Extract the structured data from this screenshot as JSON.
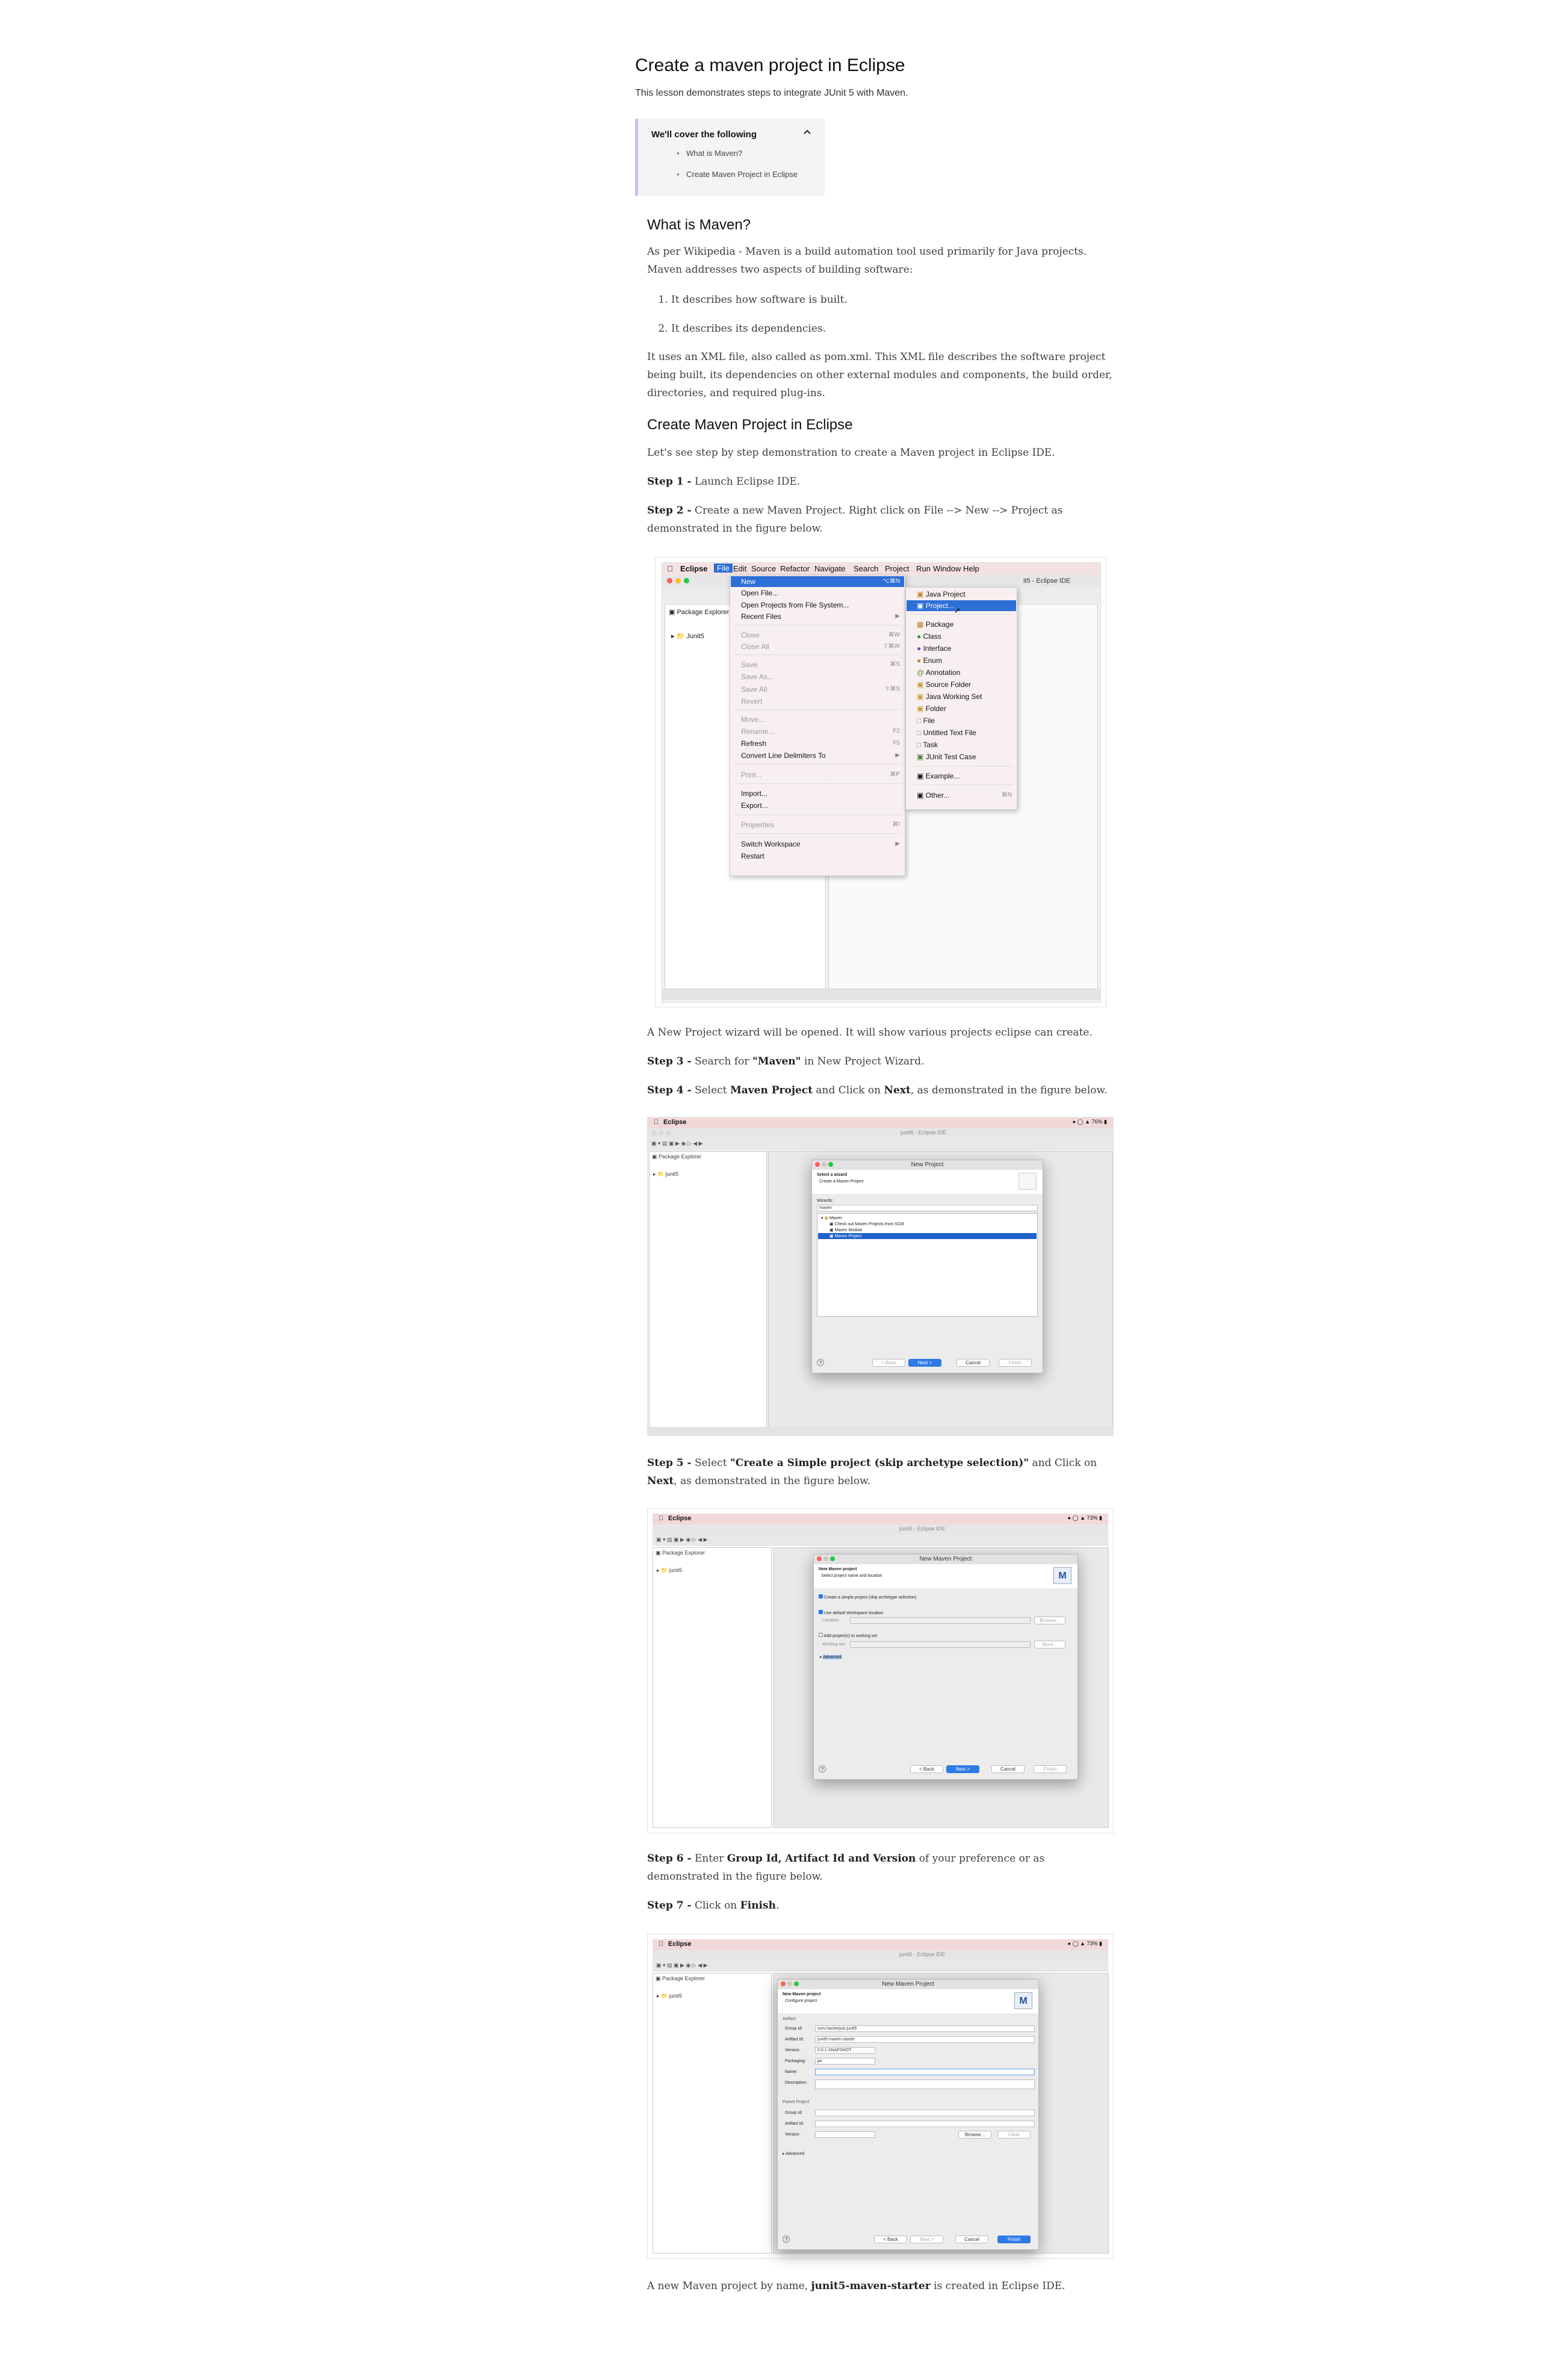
{
  "page": {
    "title": "Create a maven project in Eclipse",
    "intro": "This lesson demonstrates steps to integrate JUnit 5 with Maven."
  },
  "cover": {
    "heading": "We'll cover the following",
    "items": [
      "What is Maven?",
      "Create Maven Project in Eclipse"
    ]
  },
  "section1": {
    "heading": "What is Maven?",
    "para1": "As per Wikipedia - Maven is a build automation tool used primarily for Java projects. Maven addresses two aspects of building software:",
    "list": [
      "It describes how software is built.",
      "It describes its dependencies."
    ],
    "para2": "It uses an XML file, also called as pom.xml. This XML file describes the software project being built, its dependencies on other external modules and components, the build order, directories, and required plug-ins."
  },
  "section2": {
    "heading": "Create Maven Project in Eclipse",
    "intro": "Let's see step by step demonstration to create a Maven project in Eclipse IDE.",
    "step1_label": "Step 1 -",
    "step1_text": " Launch Eclipse IDE.",
    "step2_label": "Step 2 -",
    "step2_text": " Create a new Maven Project. Right click on File --> New --> Project as demonstrated in the figure below.",
    "wizard_note": "A New Project wizard will be opened. It will show various projects eclipse can create.",
    "step3_label": "Step 3 -",
    "step3_a": " Search for ",
    "step3_b": "\"Maven\"",
    "step3_c": " in New Project Wizard.",
    "step4_label": "Step 4 -",
    "step4_a": " Select ",
    "step4_b": "Maven Project",
    "step4_c": " and Click on ",
    "step4_d": "Next",
    "step4_e": ", as demonstrated in the figure below.",
    "step5_label": "Step 5 -",
    "step5_a": " Select ",
    "step5_b": "\"Create a Simple project (skip archetype selection)\"",
    "step5_c": " and Click on ",
    "step5_d": "Next",
    "step5_e": ", as demonstrated in the figure below.",
    "step6_label": "Step 6 -",
    "step6_a": " Enter ",
    "step6_b": "Group Id, Artifact Id and Version",
    "step6_c": " of your preference or as demonstrated in the figure below.",
    "step7_label": "Step 7 -",
    "step7_a": " Click on ",
    "step7_b": "Finish",
    "step7_c": ".",
    "final_a": "A new Maven project by name, ",
    "final_b": "junit5-maven-starter",
    "final_c": " is created in Eclipse IDE."
  },
  "shot1": {
    "menubar": [
      "Eclipse",
      "File",
      "Edit",
      "Source",
      "Refactor",
      "Navigate",
      "Search",
      "Project",
      "Run",
      "Window",
      "Help"
    ],
    "window_title": "it5 - Eclipse IDE",
    "explorer": "Package Explorer",
    "project": "Junit5",
    "file_menu": [
      {
        "label": "New",
        "sc": "⌥⌘N"
      },
      {
        "label": "Open File...",
        "sc": ""
      },
      {
        "label": "Open Projects from File System...",
        "sc": ""
      },
      {
        "label": "Recent Files",
        "sc": "▶"
      },
      {
        "label": "Close",
        "sc": "⌘W"
      },
      {
        "label": "Close All",
        "sc": "⇧⌘W"
      },
      {
        "label": "Save",
        "sc": "⌘S"
      },
      {
        "label": "Save As...",
        "sc": ""
      },
      {
        "label": "Save All",
        "sc": "⇧⌘S"
      },
      {
        "label": "Revert",
        "sc": ""
      },
      {
        "label": "Move...",
        "sc": ""
      },
      {
        "label": "Rename...",
        "sc": "F2"
      },
      {
        "label": "Refresh",
        "sc": "F5"
      },
      {
        "label": "Convert Line Delimiters To",
        "sc": "▶"
      },
      {
        "label": "Print...",
        "sc": "⌘P"
      },
      {
        "label": "Import...",
        "sc": ""
      },
      {
        "label": "Export...",
        "sc": ""
      },
      {
        "label": "Properties",
        "sc": "⌘I"
      },
      {
        "label": "Switch Workspace",
        "sc": "▶"
      },
      {
        "label": "Restart",
        "sc": ""
      }
    ],
    "new_menu": [
      {
        "label": "Java Project",
        "sc": ""
      },
      {
        "label": "Project...",
        "sc": ""
      },
      {
        "label": "Package",
        "sc": ""
      },
      {
        "label": "Class",
        "sc": ""
      },
      {
        "label": "Interface",
        "sc": ""
      },
      {
        "label": "Enum",
        "sc": ""
      },
      {
        "label": "Annotation",
        "sc": ""
      },
      {
        "label": "Source Folder",
        "sc": ""
      },
      {
        "label": "Java Working Set",
        "sc": ""
      },
      {
        "label": "Folder",
        "sc": ""
      },
      {
        "label": "File",
        "sc": ""
      },
      {
        "label": "Untitled Text File",
        "sc": ""
      },
      {
        "label": "Task",
        "sc": ""
      },
      {
        "label": "JUnit Test Case",
        "sc": ""
      },
      {
        "label": "Example...",
        "sc": ""
      },
      {
        "label": "Other...",
        "sc": "⌘N"
      }
    ]
  },
  "shot2": {
    "app": "Eclipse",
    "window_title": "junit5 - Eclipse IDE",
    "explorer": "Package Explorer",
    "project": "junit5",
    "dialog_title": "New Project",
    "head_title": "Select a wizard",
    "head_sub": "Create a Maven Project",
    "wizards_label": "Wizards:",
    "filter": "maven",
    "tree": [
      "Maven",
      "Check out Maven Projects from SCM",
      "Maven Module",
      "Maven Project"
    ],
    "buttons": [
      "< Back",
      "Next >",
      "Cancel",
      "Finish"
    ]
  },
  "shot3": {
    "app": "Eclipse",
    "window_title": "junit5 - Eclipse IDE",
    "explorer": "Package Explorer",
    "project": "junit5",
    "dialog_title": "New Maven Project",
    "head_title": "New Maven project",
    "head_sub": "Select project name and location",
    "opt1": "Create a simple project (skip archetype selection)",
    "opt2": "Use default Workspace location",
    "location": "Location:",
    "browse": "Browse...",
    "opt3": "Add project(s) to working set",
    "working_set": "Working set:",
    "more": "More...",
    "advanced": "Advanced",
    "buttons": [
      "< Back",
      "Next >",
      "Cancel",
      "Finish"
    ]
  },
  "shot4": {
    "app": "Eclipse",
    "window_title": "junit5 - Eclipse IDE",
    "explorer": "Package Explorer",
    "project": "junit5",
    "dialog_title": "New Maven Project",
    "head_title": "New Maven project",
    "head_sub": "Configure project",
    "artifact": "Artifact",
    "fields": [
      {
        "label": "Group Id:",
        "value": "com.hackerjuiz.junit5"
      },
      {
        "label": "Artifact Id:",
        "value": "junit5-maven-starter"
      },
      {
        "label": "Version:",
        "value": "0.0.1-SNAPSHOT"
      },
      {
        "label": "Packaging:",
        "value": "jar"
      },
      {
        "label": "Name:",
        "value": ""
      },
      {
        "label": "Description:",
        "value": ""
      }
    ],
    "parent": "Parent Project",
    "parent_fields": [
      "Group Id:",
      "Artifact Id:",
      "Version:"
    ],
    "browse": "Browse...",
    "clear": "Clear",
    "advanced": "Advanced",
    "buttons": [
      "< Back",
      "Next >",
      "Cancel",
      "Finish"
    ]
  }
}
